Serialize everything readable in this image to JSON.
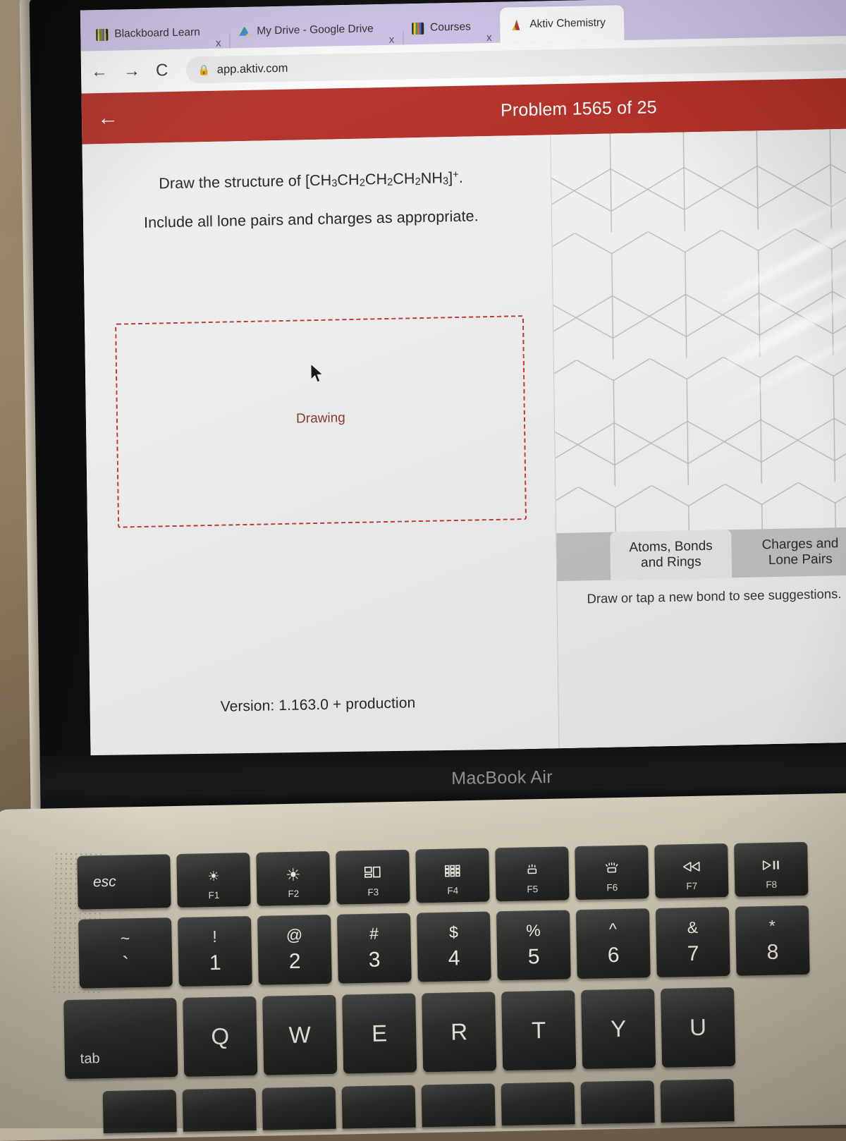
{
  "browser": {
    "tabs": [
      {
        "title": "Blackboard Learn",
        "favicon": "blackboard-icon",
        "active": false,
        "close_label": "x"
      },
      {
        "title": "My Drive - Google Drive",
        "favicon": "google-drive-icon",
        "active": false,
        "close_label": "x"
      },
      {
        "title": "Courses",
        "favicon": "courses-icon",
        "active": false,
        "close_label": "x"
      },
      {
        "title": "Aktiv Chemistry",
        "favicon": "aktiv-chemistry-icon",
        "active": true,
        "close_label": ""
      }
    ],
    "nav": {
      "back_icon": "←",
      "forward_icon": "→",
      "reload_icon": "C",
      "lock_icon": "🔒"
    },
    "url": "app.aktiv.com"
  },
  "app": {
    "header": {
      "back_icon": "←",
      "problem_counter": "Problem 1565 of 25",
      "accent_color": "#b3322a"
    },
    "prompt": {
      "line1_prefix": "Draw the structure of [CH",
      "line1_full": "Draw the structure of [CH3CH2CH2CH2NH3]+.",
      "line2": "Include all lone pairs and charges as appropriate."
    },
    "canvas": {
      "placeholder": "Drawing",
      "placeholder_color": "#8a3b33",
      "border_color": "#c0392f"
    },
    "version": "Version: 1.163.0 +  production",
    "tool_panel": {
      "tabs": [
        {
          "label_line1": "Atoms, Bonds",
          "label_line2": "and Rings",
          "active": true
        },
        {
          "label_line1": "Charges and",
          "label_line2": "Lone Pairs",
          "active": false
        }
      ],
      "hint": "Draw or tap a new bond to see suggestions."
    }
  },
  "laptop": {
    "brand": "MacBook Air",
    "function_row": [
      {
        "label": "esc",
        "glyph": ""
      },
      {
        "label": "F1",
        "glyph": "brightness-down-icon"
      },
      {
        "label": "F2",
        "glyph": "brightness-up-icon"
      },
      {
        "label": "F3",
        "glyph": "mission-control-icon"
      },
      {
        "label": "F4",
        "glyph": "launchpad-icon"
      },
      {
        "label": "F5",
        "glyph": "keyboard-brightness-down-icon"
      },
      {
        "label": "F6",
        "glyph": "keyboard-brightness-up-icon"
      },
      {
        "label": "F7",
        "glyph": "rewind-icon"
      },
      {
        "label": "F8",
        "glyph": "play-pause-icon"
      }
    ],
    "number_row": [
      {
        "top": "~",
        "bottom": "`"
      },
      {
        "top": "!",
        "bottom": "1"
      },
      {
        "top": "@",
        "bottom": "2"
      },
      {
        "top": "#",
        "bottom": "3"
      },
      {
        "top": "$",
        "bottom": "4"
      },
      {
        "top": "%",
        "bottom": "5"
      },
      {
        "top": "^",
        "bottom": "6"
      },
      {
        "top": "&",
        "bottom": "7"
      },
      {
        "top": "*",
        "bottom": "8"
      }
    ],
    "qwerty_row": [
      {
        "label": "tab"
      },
      {
        "label": "Q"
      },
      {
        "label": "W"
      },
      {
        "label": "E"
      },
      {
        "label": "R"
      },
      {
        "label": "T"
      },
      {
        "label": "Y"
      },
      {
        "label": "U"
      }
    ]
  }
}
